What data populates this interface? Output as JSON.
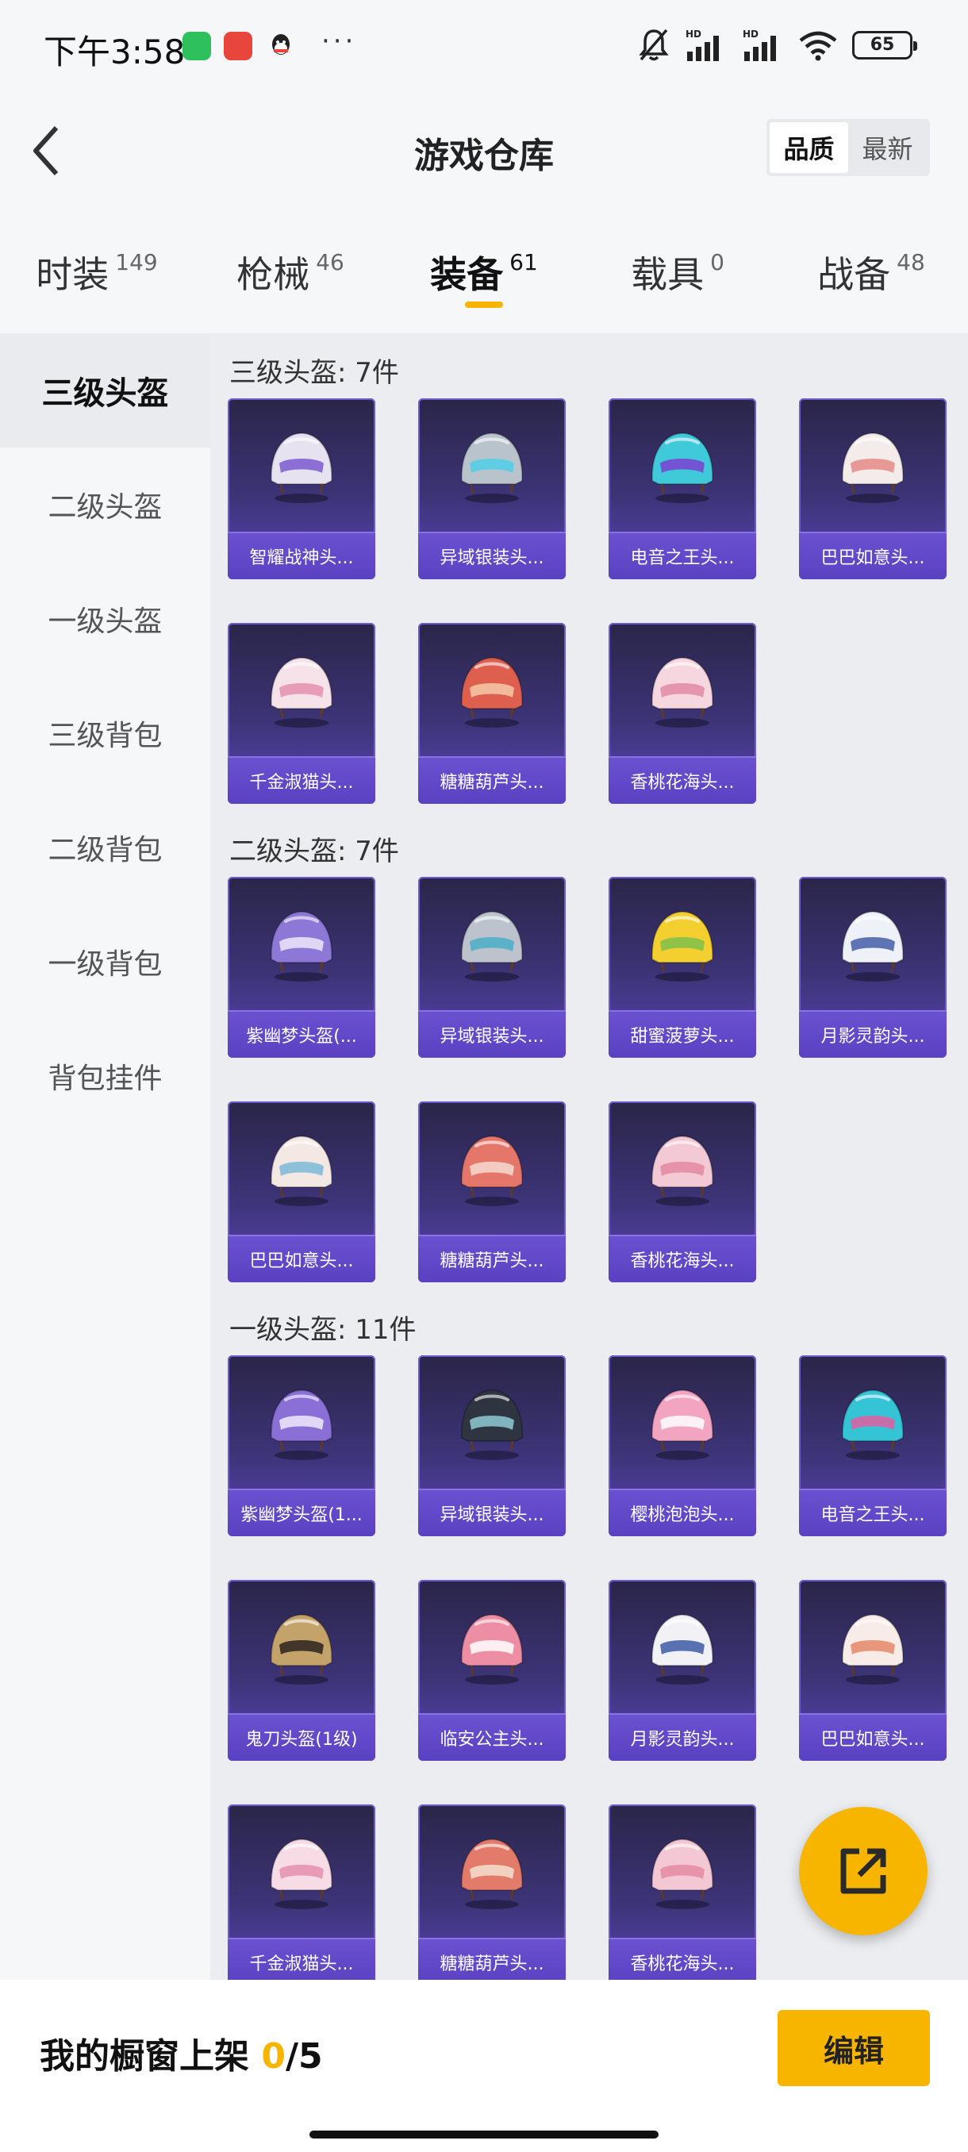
{
  "status_bar": {
    "time": "下午3:58",
    "more": "···",
    "battery": "65",
    "network_label": "HD",
    "icons": [
      "wechat-icon",
      "shop-app-icon",
      "qq-icon",
      "mute-bell-icon",
      "signal-icon",
      "signal-icon",
      "wifi-icon",
      "battery-icon"
    ]
  },
  "header": {
    "title": "游戏仓库",
    "sort_quality": "品质",
    "sort_newest": "最新"
  },
  "tabs": [
    {
      "label": "时装",
      "count": "149"
    },
    {
      "label": "枪械",
      "count": "46"
    },
    {
      "label": "装备",
      "count": "61",
      "active": true
    },
    {
      "label": "载具",
      "count": "0"
    },
    {
      "label": "战备",
      "count": "48"
    }
  ],
  "sidebar": {
    "items": [
      {
        "label": "三级头盔",
        "active": true
      },
      {
        "label": "二级头盔"
      },
      {
        "label": "一级头盔"
      },
      {
        "label": "三级背包"
      },
      {
        "label": "二级背包"
      },
      {
        "label": "一级背包"
      },
      {
        "label": "背包挂件"
      }
    ]
  },
  "sections": [
    {
      "title": "三级头盔: 7件",
      "items": [
        {
          "name": "智耀战神头...",
          "color": "#e7e2ef",
          "accent": "#7a5bd0"
        },
        {
          "name": "异域银装头...",
          "color": "#b9c3cc",
          "accent": "#4fd0e8"
        },
        {
          "name": "电音之王头...",
          "color": "#3fc9d9",
          "accent": "#7c3fd0"
        },
        {
          "name": "巴巴如意头...",
          "color": "#f4ecea",
          "accent": "#e58a86"
        },
        {
          "name": "千金淑猫头...",
          "color": "#f5e3e9",
          "accent": "#e48fae"
        },
        {
          "name": "糖糖葫芦头...",
          "color": "#de5f4e",
          "accent": "#f6c9a8"
        },
        {
          "name": "香桃花海头...",
          "color": "#f6d7e0",
          "accent": "#e38aa5"
        }
      ]
    },
    {
      "title": "二级头盔: 7件",
      "items": [
        {
          "name": "紫幽梦头盔(...",
          "color": "#8d78d8",
          "accent": "#efe6fb"
        },
        {
          "name": "异域银装头...",
          "color": "#bcc3cc",
          "accent": "#4aaec6"
        },
        {
          "name": "甜蜜菠萝头...",
          "color": "#f3cf2f",
          "accent": "#7cc14b"
        },
        {
          "name": "月影灵韵头...",
          "color": "#eef1f7",
          "accent": "#445ea8"
        },
        {
          "name": "巴巴如意头...",
          "color": "#f4e8e4",
          "accent": "#7bb9d8"
        },
        {
          "name": "糖糖葫芦头...",
          "color": "#e4776a",
          "accent": "#f7d9cf"
        },
        {
          "name": "香桃花海头...",
          "color": "#f2c9d4",
          "accent": "#e48aa2"
        }
      ]
    },
    {
      "title": "一级头盔: 11件",
      "items": [
        {
          "name": "紫幽梦头盔(1...",
          "color": "#8a6fd6",
          "accent": "#f0eafc"
        },
        {
          "name": "异域银装头...",
          "color": "#2f3540",
          "accent": "#8fc9d4"
        },
        {
          "name": "樱桃泡泡头...",
          "color": "#f3a4c0",
          "accent": "#ffffff"
        },
        {
          "name": "电音之王头...",
          "color": "#35c3d6",
          "accent": "#e05fa0"
        },
        {
          "name": "鬼刀头盔(1级)",
          "color": "#c3a36a",
          "accent": "#2b2320"
        },
        {
          "name": "临安公主头...",
          "color": "#ee8ea4",
          "accent": "#ffffff"
        },
        {
          "name": "月影灵韵头...",
          "color": "#f2f2f6",
          "accent": "#3d5aa6"
        },
        {
          "name": "巴巴如意头...",
          "color": "#f7ece8",
          "accent": "#e58769"
        },
        {
          "name": "千金淑猫头...",
          "color": "#f7dce5",
          "accent": "#e48fae"
        },
        {
          "name": "糖糖葫芦头...",
          "color": "#e37b6b",
          "accent": "#f6e0cf"
        },
        {
          "name": "香桃花海头...",
          "color": "#f3c7d3",
          "accent": "#e48aa2"
        }
      ]
    }
  ],
  "bottom_bar": {
    "shelf_label": "我的橱窗上架",
    "shelf_current": "0",
    "shelf_total": "/5",
    "edit_label": "编辑"
  },
  "fab": {
    "icon": "share-external-icon"
  },
  "colors": {
    "accent": "#f7b500",
    "card_bg": "#3d3478",
    "card_caption": "#6a51d0"
  }
}
